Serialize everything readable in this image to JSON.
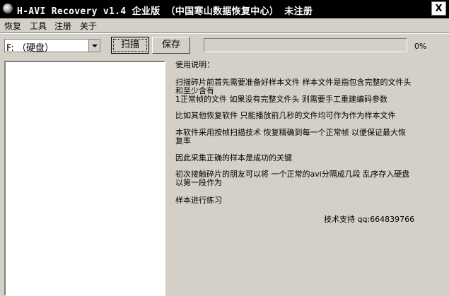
{
  "window": {
    "title": "H-AVI Recovery v1.4 企业版 （中国寒山数据恢复中心） 未注册",
    "close_label": "X"
  },
  "menu": [
    "恢复",
    "工具",
    "注册",
    "关于"
  ],
  "toolbar": {
    "drive_selected": "F: （硬盘）",
    "scan_label": "扫描",
    "save_label": "保存",
    "progress_value": 0,
    "progress_text": "0%"
  },
  "instructions": {
    "heading": "使用说明：",
    "lines": [
      "扫描碎片前首先需要准备好样本文件 样本文件是指包含完整的文件头",
      "和至少含有",
      "1正常帧的文件   如果没有完整文件头 则需要手工重建编码参数",
      "比如其他恢复软件 只能播放前几秒的文件均可作为作为样本文件",
      "本软件采用按帧扫描技术 恢复精确到每一个正常帧  以便保证最大恢",
      "复率",
      "因此采集正确的样本是成功的关键",
      "初次接触碎片的朋友可以将 一个正常的avi分隔成几段 乱序存入硬盘",
      "以第一段作为",
      "样本进行练习"
    ],
    "support": "技术支持 qq:664839766"
  }
}
